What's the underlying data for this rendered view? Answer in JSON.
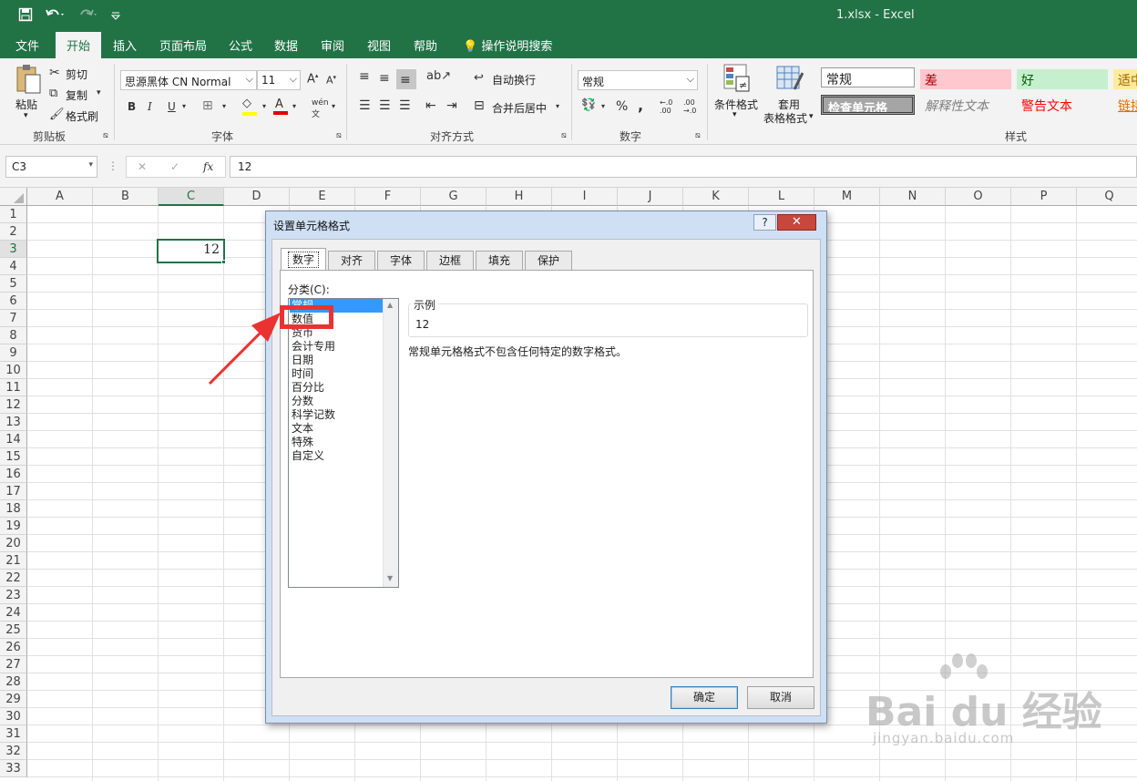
{
  "window": {
    "title": "1.xlsx  -  Excel"
  },
  "qat": {
    "save_icon": "save-icon",
    "undo_icon": "undo-icon",
    "redo_icon": "redo-icon",
    "customize_icon": "customize-icon"
  },
  "tabs": [
    {
      "label": "文件"
    },
    {
      "label": "开始"
    },
    {
      "label": "插入"
    },
    {
      "label": "页面布局"
    },
    {
      "label": "公式"
    },
    {
      "label": "数据"
    },
    {
      "label": "审阅"
    },
    {
      "label": "视图"
    },
    {
      "label": "帮助"
    },
    {
      "label": "操作说明搜索"
    }
  ],
  "ribbon": {
    "clipboard": {
      "paste": "粘贴",
      "cut": "剪切",
      "copy": "复制",
      "format_painter": "格式刷",
      "group": "剪贴板"
    },
    "font": {
      "font_name": "思源黑体 CN Normal",
      "font_size": "11",
      "group": "字体",
      "bold": "B",
      "italic": "I",
      "underline": "U",
      "grow": "A",
      "shrink": "A",
      "phonetic": "wén"
    },
    "alignment": {
      "wrap": "自动换行",
      "merge": "合并后居中",
      "group": "对齐方式"
    },
    "number": {
      "format": "常规",
      "percent": "%",
      "comma": ",",
      "inc_decimal": "←.0 .00",
      "dec_decimal": ".00 →.0",
      "group": "数字"
    },
    "styles": {
      "conditional_format": "条件格式",
      "table_format_line1": "套用",
      "table_format_line2": "表格格式",
      "group": "样式",
      "normal": "常规",
      "bad": "差",
      "good": "好",
      "neutral": "适中",
      "check_cell": "检查单元格",
      "explanatory": "解释性文本",
      "warning": "警告文本",
      "link": "链接"
    }
  },
  "formula_bar": {
    "name_box": "C3",
    "cancel": "✕",
    "enter": "✓",
    "fx": "fx",
    "formula": "12"
  },
  "sheet": {
    "columns": [
      "A",
      "B",
      "C",
      "D",
      "E",
      "F",
      "G",
      "H",
      "I",
      "J",
      "K",
      "L",
      "M",
      "N",
      "O",
      "P",
      "Q"
    ],
    "rows": [
      "1",
      "2",
      "3",
      "4",
      "5",
      "6",
      "7",
      "8",
      "9",
      "10",
      "11",
      "12",
      "13",
      "14",
      "15",
      "16",
      "17",
      "18",
      "19",
      "20",
      "21",
      "22",
      "23",
      "24",
      "25",
      "26",
      "27",
      "28",
      "29",
      "30",
      "31",
      "32",
      "33"
    ],
    "active_cell": "C3",
    "cell_c3": "12"
  },
  "dialog": {
    "title": "设置单元格格式",
    "help": "?",
    "close": "✕",
    "tabs": [
      {
        "label": "数字"
      },
      {
        "label": "对齐"
      },
      {
        "label": "字体"
      },
      {
        "label": "边框"
      },
      {
        "label": "填充"
      },
      {
        "label": "保护"
      }
    ],
    "category_label": "分类(C):",
    "categories": [
      {
        "label": "常规"
      },
      {
        "label": "数值"
      },
      {
        "label": "货币"
      },
      {
        "label": "会计专用"
      },
      {
        "label": "日期"
      },
      {
        "label": "时间"
      },
      {
        "label": "百分比"
      },
      {
        "label": "分数"
      },
      {
        "label": "科学记数"
      },
      {
        "label": "文本"
      },
      {
        "label": "特殊"
      },
      {
        "label": "自定义"
      }
    ],
    "selected_category": "常规",
    "sample_label": "示例",
    "sample_value": "12",
    "description": "常规单元格格式不包含任何特定的数字格式。",
    "ok": "确定",
    "cancel": "取消"
  },
  "annotation": {
    "color": "#ea3232",
    "target": "数值"
  },
  "watermark": {
    "logo": "Bai du 经验",
    "url": "jingyan.baidu.com"
  },
  "colors": {
    "excel_green": "#217346",
    "selection_blue": "#3399ff"
  }
}
